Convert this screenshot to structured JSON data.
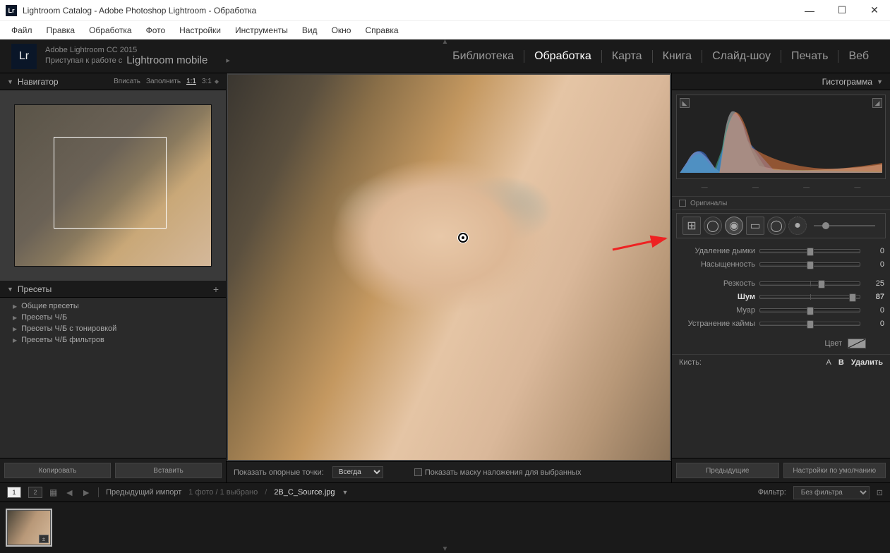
{
  "title": "Lightroom Catalog - Adobe Photoshop Lightroom - Обработка",
  "logo": "Lr",
  "menu": [
    "Файл",
    "Правка",
    "Обработка",
    "Фото",
    "Настройки",
    "Инструменты",
    "Вид",
    "Окно",
    "Справка"
  ],
  "brand": {
    "line1": "Adobe Lightroom CC 2015",
    "line2a": "Приступая к работе с",
    "line2b": "Lightroom mobile"
  },
  "modules": [
    {
      "label": "Библиотека",
      "active": false
    },
    {
      "label": "Обработка",
      "active": true
    },
    {
      "label": "Карта",
      "active": false
    },
    {
      "label": "Книга",
      "active": false
    },
    {
      "label": "Слайд-шоу",
      "active": false
    },
    {
      "label": "Печать",
      "active": false
    },
    {
      "label": "Веб",
      "active": false
    }
  ],
  "navigator": {
    "title": "Навигатор",
    "zoom": [
      "Вписать",
      "Заполнить",
      "1:1",
      "3:1"
    ]
  },
  "presets": {
    "title": "Пресеты",
    "items": [
      "Общие пресеты",
      "Пресеты Ч/Б",
      "Пресеты Ч/Б с тонировкой",
      "Пресеты Ч/Б фильтров"
    ]
  },
  "leftButtons": {
    "copy": "Копировать",
    "paste": "Вставить"
  },
  "canvasBar": {
    "showPoints": "Показать опорные точки:",
    "always": "Всегда",
    "showMask": "Показать маску наложения для выбранных"
  },
  "histogram": {
    "title": "Гистограмма",
    "originals": "Оригиналы",
    "stats": [
      "—",
      "—",
      "—",
      "—"
    ]
  },
  "sliders": [
    {
      "label": "Удаление дымки",
      "value": 0,
      "pos": 50
    },
    {
      "label": "Насыщенность",
      "value": 0,
      "pos": 50
    },
    {
      "label": "Резкость",
      "value": 25,
      "pos": 62
    },
    {
      "label": "Шум",
      "value": 87,
      "pos": 93,
      "highlight": true
    },
    {
      "label": "Муар",
      "value": 0,
      "pos": 50
    },
    {
      "label": "Устранение каймы",
      "value": 0,
      "pos": 50
    }
  ],
  "colorLabel": "Цвет",
  "brush": {
    "label": "Кисть:",
    "a": "A",
    "b": "B",
    "delete": "Удалить"
  },
  "rightButtons": {
    "prev": "Предыдущие",
    "defaults": "Настройки по умолчанию"
  },
  "filmHead": {
    "view1": "1",
    "view2": "2",
    "prevImport": "Предыдущий импорт",
    "count": "1 фото  /  1 выбрано",
    "filename": "2B_C_Source.jpg",
    "filterLabel": "Фильтр:",
    "filterValue": "Без фильтра"
  }
}
